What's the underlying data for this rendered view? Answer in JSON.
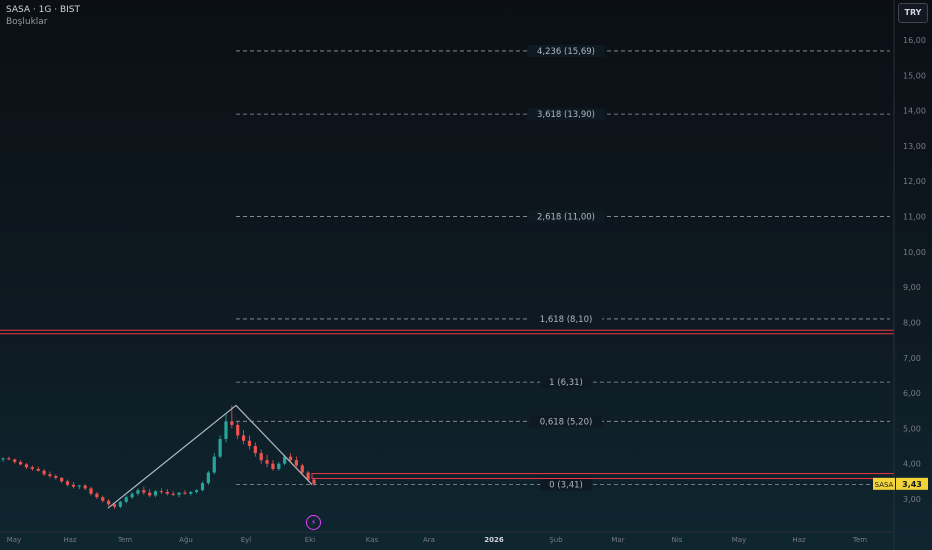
{
  "header": {
    "symbol": "SASA · 1G · BIST",
    "indicator": "Boşluklar"
  },
  "currency_button": "TRY",
  "event_icon": "lightning-icon",
  "colors": {
    "up": "#26a69a",
    "down": "#ef5350",
    "fib": "#9598a1",
    "resistance": "#f23645",
    "zigzag": "#b2b5be",
    "last_price": "#f0d43a",
    "gap_box": "#66bb6a"
  },
  "chart_data": {
    "type": "candlestick",
    "title": "SASA · 1G · BIST",
    "ylim": [
      2.5,
      16.5
    ],
    "y_ticks": [
      "3,00",
      "4,00",
      "5,00",
      "6,00",
      "7,00",
      "8,00",
      "9,00",
      "10,00",
      "11,00",
      "12,00",
      "13,00",
      "14,00",
      "15,00",
      "16,00"
    ],
    "y_tick_values": [
      3,
      4,
      5,
      6,
      7,
      8,
      9,
      10,
      11,
      12,
      13,
      14,
      15,
      16
    ],
    "x_ticks": [
      "May",
      "Haz",
      "Tem",
      "Ağu",
      "Eyl",
      "Eki",
      "Kas",
      "Ara",
      "2026",
      "Şub",
      "Mar",
      "Nis",
      "May",
      "Haz",
      "Tem"
    ],
    "fib_levels": [
      {
        "label": "4,236 (15,69)",
        "value": 15.69
      },
      {
        "label": "3,618 (13,90)",
        "value": 13.9
      },
      {
        "label": "2,618 (11,00)",
        "value": 11.0
      },
      {
        "label": "1,618 (8,10)",
        "value": 8.1
      },
      {
        "label": "1 (6,31)",
        "value": 6.31
      },
      {
        "label": "0,618 (5,20)",
        "value": 5.2
      },
      {
        "label": "0 (3,41)",
        "value": 3.41
      }
    ],
    "resistance_lines": [
      7.68,
      7.78
    ],
    "resistance_band_right": [
      3.58,
      3.72
    ],
    "zigzag": [
      {
        "x": "Tem",
        "value": 2.74
      },
      {
        "x": "Eyl",
        "value": 5.65
      },
      {
        "x": "Eki",
        "value": 3.41
      }
    ],
    "candles": [
      [
        4.12,
        4.18,
        4.05,
        4.15
      ],
      [
        4.15,
        4.2,
        4.1,
        4.12
      ],
      [
        4.12,
        4.15,
        4.0,
        4.05
      ],
      [
        4.05,
        4.1,
        3.95,
        3.98
      ],
      [
        3.98,
        4.02,
        3.85,
        3.9
      ],
      [
        3.9,
        3.95,
        3.8,
        3.85
      ],
      [
        3.85,
        3.92,
        3.78,
        3.8
      ],
      [
        3.8,
        3.85,
        3.65,
        3.7
      ],
      [
        3.7,
        3.78,
        3.6,
        3.65
      ],
      [
        3.65,
        3.7,
        3.55,
        3.6
      ],
      [
        3.6,
        3.62,
        3.45,
        3.5
      ],
      [
        3.5,
        3.55,
        3.35,
        3.4
      ],
      [
        3.4,
        3.48,
        3.3,
        3.35
      ],
      [
        3.35,
        3.4,
        3.28,
        3.38
      ],
      [
        3.38,
        3.42,
        3.25,
        3.3
      ],
      [
        3.3,
        3.35,
        3.1,
        3.15
      ],
      [
        3.15,
        3.2,
        3.0,
        3.05
      ],
      [
        3.05,
        3.1,
        2.9,
        2.95
      ],
      [
        2.95,
        3.0,
        2.8,
        2.85
      ],
      [
        2.85,
        2.9,
        2.72,
        2.78
      ],
      [
        2.78,
        2.95,
        2.74,
        2.92
      ],
      [
        2.92,
        3.1,
        2.88,
        3.05
      ],
      [
        3.05,
        3.2,
        3.0,
        3.15
      ],
      [
        3.15,
        3.3,
        3.1,
        3.25
      ],
      [
        3.25,
        3.35,
        3.12,
        3.18
      ],
      [
        3.18,
        3.28,
        3.05,
        3.1
      ],
      [
        3.1,
        3.25,
        3.05,
        3.22
      ],
      [
        3.22,
        3.3,
        3.15,
        3.2
      ],
      [
        3.2,
        3.28,
        3.1,
        3.15
      ],
      [
        3.15,
        3.22,
        3.08,
        3.12
      ],
      [
        3.12,
        3.2,
        3.05,
        3.18
      ],
      [
        3.18,
        3.25,
        3.12,
        3.15
      ],
      [
        3.15,
        3.22,
        3.1,
        3.2
      ],
      [
        3.2,
        3.28,
        3.15,
        3.25
      ],
      [
        3.25,
        3.5,
        3.22,
        3.45
      ],
      [
        3.45,
        3.8,
        3.4,
        3.75
      ],
      [
        3.75,
        4.3,
        3.7,
        4.2
      ],
      [
        4.2,
        4.8,
        4.15,
        4.7
      ],
      [
        4.7,
        5.4,
        4.6,
        5.2
      ],
      [
        5.2,
        5.65,
        5.0,
        5.1
      ],
      [
        5.1,
        5.2,
        4.7,
        4.8
      ],
      [
        4.8,
        4.95,
        4.55,
        4.65
      ],
      [
        4.65,
        4.8,
        4.4,
        4.5
      ],
      [
        4.5,
        4.6,
        4.2,
        4.3
      ],
      [
        4.3,
        4.4,
        4.0,
        4.1
      ],
      [
        4.1,
        4.25,
        3.9,
        4.0
      ],
      [
        4.0,
        4.1,
        3.8,
        3.85
      ],
      [
        3.85,
        4.05,
        3.8,
        4.0
      ],
      [
        4.0,
        4.25,
        3.95,
        4.2
      ],
      [
        4.2,
        4.3,
        4.05,
        4.1
      ],
      [
        4.1,
        4.2,
        3.9,
        3.95
      ],
      [
        3.95,
        4.0,
        3.7,
        3.75
      ],
      [
        3.75,
        3.8,
        3.5,
        3.55
      ],
      [
        3.55,
        3.6,
        3.38,
        3.43
      ]
    ],
    "last_price": {
      "symbol": "SASA",
      "value": 3.43,
      "label": "3,43"
    }
  }
}
